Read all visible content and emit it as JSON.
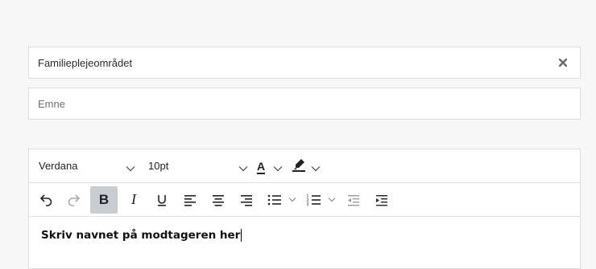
{
  "form": {
    "area_field": {
      "value": "Familieplejeområdet"
    },
    "subject_field": {
      "placeholder": "Emne"
    }
  },
  "editor": {
    "font_family": "Verdana",
    "font_size": "10pt",
    "text_color_letter": "A",
    "text_color": "#222222",
    "highlight_color": "#222222",
    "content_text": "Skriv navnet på modtageren her",
    "toolbar_active": "bold"
  }
}
